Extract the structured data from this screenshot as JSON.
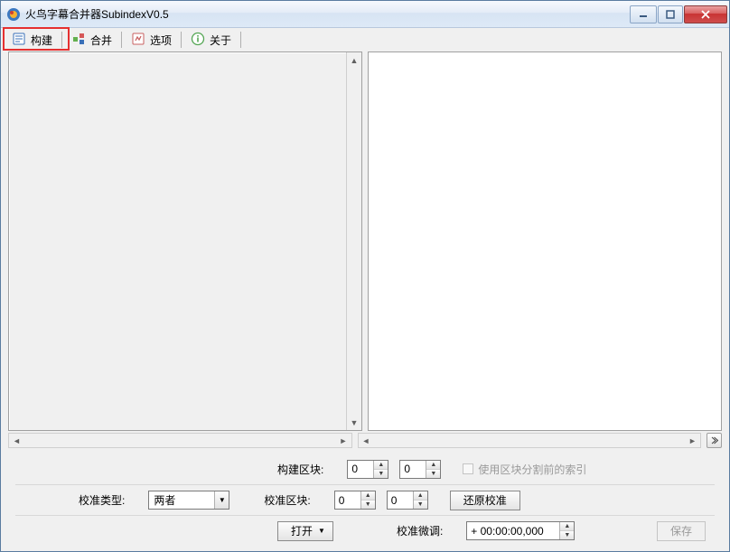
{
  "window": {
    "title": "火鸟字幕合并器SubindexV0.5"
  },
  "toolbar": {
    "build": "构建",
    "merge": "合并",
    "options": "选项",
    "about": "关于"
  },
  "controls": {
    "build_block_label": "构建区块:",
    "build_block_a": "0",
    "build_block_b": "0",
    "use_presplit_index_label": "使用区块分割前的索引",
    "calib_type_label": "校准类型:",
    "calib_type_value": "两者",
    "calib_block_label": "校准区块:",
    "calib_block_a": "0",
    "calib_block_b": "0",
    "revert_calib_btn": "还原校准",
    "open_btn": "打开",
    "calib_fine_label": "校准微调:",
    "calib_fine_value": "+ 00:00:00,000",
    "save_btn": "保存"
  }
}
